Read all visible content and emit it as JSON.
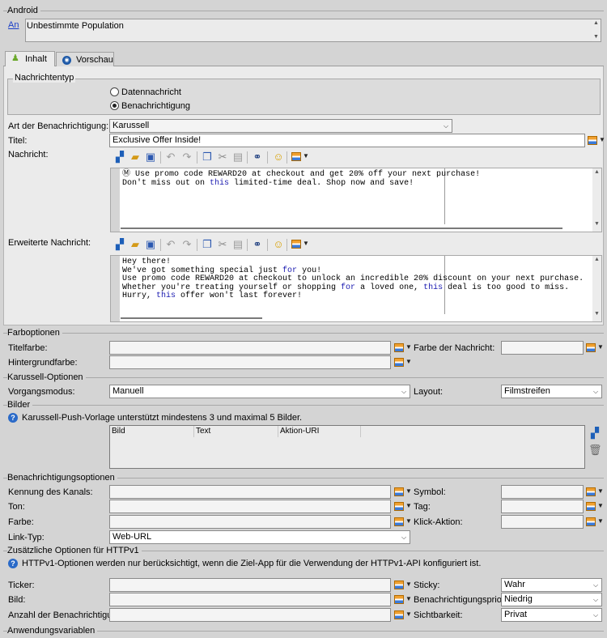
{
  "android": {
    "title": "Android",
    "link": "An",
    "population": "Unbestimmte Population"
  },
  "tabs": [
    {
      "label": "Inhalt",
      "icon": "android-icon",
      "active": true
    },
    {
      "label": "Vorschau",
      "icon": "eye-icon",
      "active": false
    }
  ],
  "nachrichtentyp": {
    "title": "Nachrichtentyp",
    "options": [
      "Datennachricht",
      "Benachrichtigung"
    ],
    "selected": "Benachrichtigung"
  },
  "content": {
    "art_label": "Art der Benachrichtigung:",
    "art_value": "Karussell",
    "titel_label": "Titel:",
    "titel_value": "Exclusive Offer Inside!",
    "nachricht_label": "Nachricht:",
    "nachricht_lines": [
      "Ⓜ Use promo code REWARD20 at checkout and get 20% off your next purchase!",
      "Don't miss out on this limited-time deal. Shop now and save!"
    ],
    "erweitert_label": "Erweiterte Nachricht:",
    "erweitert_lines": [
      "Hey there!",
      "We've got something special just for you!",
      "Use promo code REWARD20 at checkout to unlock an incredible 20% discount on your next purchase.",
      "Whether you're treating yourself or shopping for a loved one, this deal is too good to miss.",
      "Hurry, this offer won't last forever!"
    ]
  },
  "farboptionen": {
    "title": "Farboptionen",
    "titelfarbe_label": "Titelfarbe:",
    "titelfarbe_value": "",
    "hintergrund_label": "Hintergrundfarbe:",
    "hintergrund_value": "",
    "farbe_nachricht_label": "Farbe der Nachricht:",
    "farbe_nachricht_value": ""
  },
  "karussell": {
    "title": "Karussell-Optionen",
    "vorgang_label": "Vorgangsmodus:",
    "vorgang_value": "Manuell",
    "layout_label": "Layout:",
    "layout_value": "Filmstreifen"
  },
  "bilder": {
    "title": "Bilder",
    "info": "Karussell-Push-Vorlage unterstützt mindestens 3 und maximal 5 Bilder.",
    "columns": [
      "Bild",
      "Text",
      "Aktion-URI"
    ]
  },
  "benachrichtigungsoptionen": {
    "title": "Benachrichtigungsoptionen",
    "kanal_label": "Kennung des Kanals:",
    "ton_label": "Ton:",
    "farbe_label": "Farbe:",
    "symbol_label": "Symbol:",
    "tag_label": "Tag:",
    "klick_label": "Klick-Aktion:",
    "linktyp_label": "Link-Typ:",
    "linktyp_value": "Web-URL"
  },
  "httpv1": {
    "title": "Zusätzliche Optionen für HTTPv1",
    "info": "HTTPv1-Optionen werden nur berücksichtigt, wenn die Ziel-App für die Verwendung der HTTPv1-API konfiguriert ist.",
    "ticker_label": "Ticker:",
    "bild_label": "Bild:",
    "anzahl_label": "Anzahl der Benachrichtigungen:",
    "sticky_label": "Sticky:",
    "sticky_value": "Wahr",
    "prio_label": "Benachrichtigungspriorität:",
    "prio_value": "Niedrig",
    "sicht_label": "Sichtbarkeit:",
    "sicht_value": "Privat"
  },
  "anwendungsvariablen": {
    "title": "Anwendungsvariablen"
  }
}
